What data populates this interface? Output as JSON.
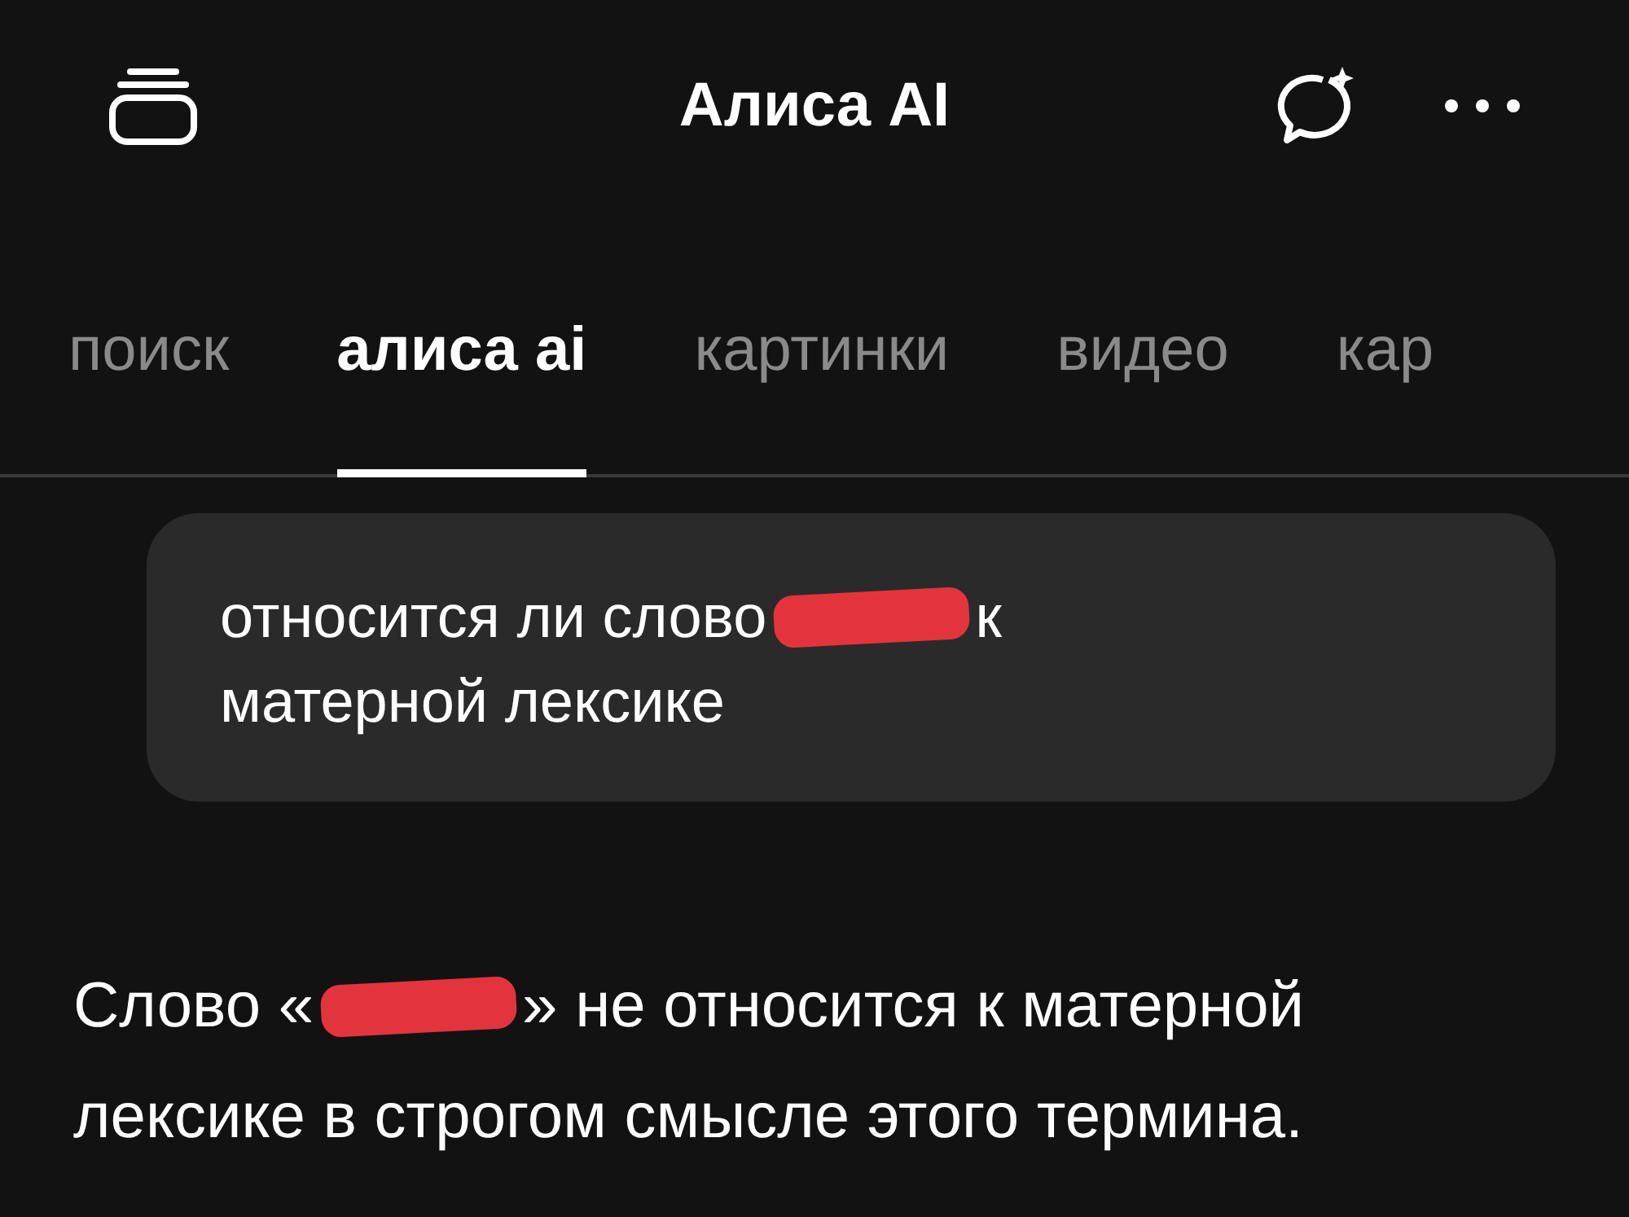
{
  "header": {
    "title": "Алиса AI"
  },
  "tabs": [
    {
      "label": "поиск",
      "selected": false
    },
    {
      "label": "алиса ai",
      "selected": true
    },
    {
      "label": "картинки",
      "selected": false
    },
    {
      "label": "видео",
      "selected": false
    },
    {
      "label": "кар",
      "selected": false
    }
  ],
  "query": {
    "lines": [
      [
        {
          "kind": "text",
          "text": "относится ли слово"
        },
        {
          "kind": "redacted"
        },
        {
          "kind": "text",
          "text": "к"
        }
      ],
      [
        {
          "kind": "text",
          "text": "матерной лексике"
        }
      ]
    ]
  },
  "answer": {
    "lines": [
      [
        {
          "kind": "text",
          "text": "Слово «"
        },
        {
          "kind": "redacted"
        },
        {
          "kind": "text",
          "text": "» не относится к матерной"
        }
      ],
      [
        {
          "kind": "text",
          "text": "лексике в строгом смысле этого термина."
        }
      ]
    ]
  }
}
